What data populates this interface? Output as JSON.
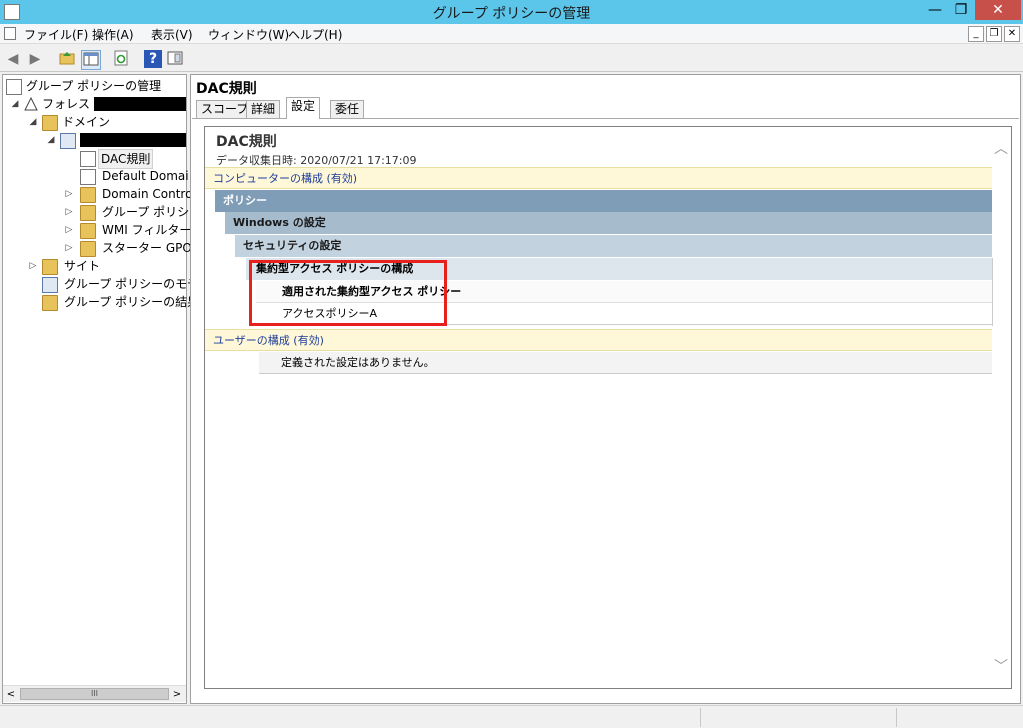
{
  "window": {
    "title": "グループ ポリシーの管理",
    "min": "—",
    "max": "❐",
    "close": "✕"
  },
  "menu": {
    "file": "ファイル(F)",
    "action": "操作(A)",
    "view": "表示(V)",
    "window": "ウィンドウ(W)",
    "help": "ヘルプ(H)",
    "mdi_min": "_",
    "mdi_restore": "❐",
    "mdi_close": "✕"
  },
  "toolbar": {
    "back": "◀",
    "forward": "▶",
    "help": "?"
  },
  "tree": {
    "root": "グループ ポリシーの管理",
    "forest": "フォレスト:",
    "domains": "ドメイン",
    "dac_rule": "DAC規則",
    "default_domain": "Default Domai",
    "domain_controllers": "Domain Contro",
    "group_policy": "グループ ポリシー",
    "wmi_filter": "WMI フィルター",
    "starter_gpo": "スターター GPO",
    "sites": "サイト",
    "modeling": "グループ ポリシーのモデル",
    "results": "グループ ポリシーの結果",
    "expanded": "◢",
    "collapsed": "▷"
  },
  "tree_scroll": {
    "left": "<",
    "right": ">",
    "thumb": "III"
  },
  "right": {
    "title": "DAC規則",
    "tabs": {
      "scope": "スコープ",
      "details": "詳細",
      "settings": "設定",
      "delegation": "委任"
    }
  },
  "report": {
    "title": "DAC規則",
    "date": "データ収集日時: 2020/07/21 17:17:09",
    "computer_config": "コンピューターの構成 (有効)",
    "policies": "ポリシー",
    "windows_settings": "Windows の設定",
    "security_settings": "セキュリティの設定",
    "cap_config": "集約型アクセス ポリシーの構成",
    "applied_cap": "適用された集約型アクセス ポリシー",
    "access_policy": "アクセスポリシーA",
    "user_config": "ユーザーの構成 (有効)",
    "no_settings": "定義された設定はありません。",
    "scroll_up": "︿",
    "scroll_down": "﹀"
  }
}
